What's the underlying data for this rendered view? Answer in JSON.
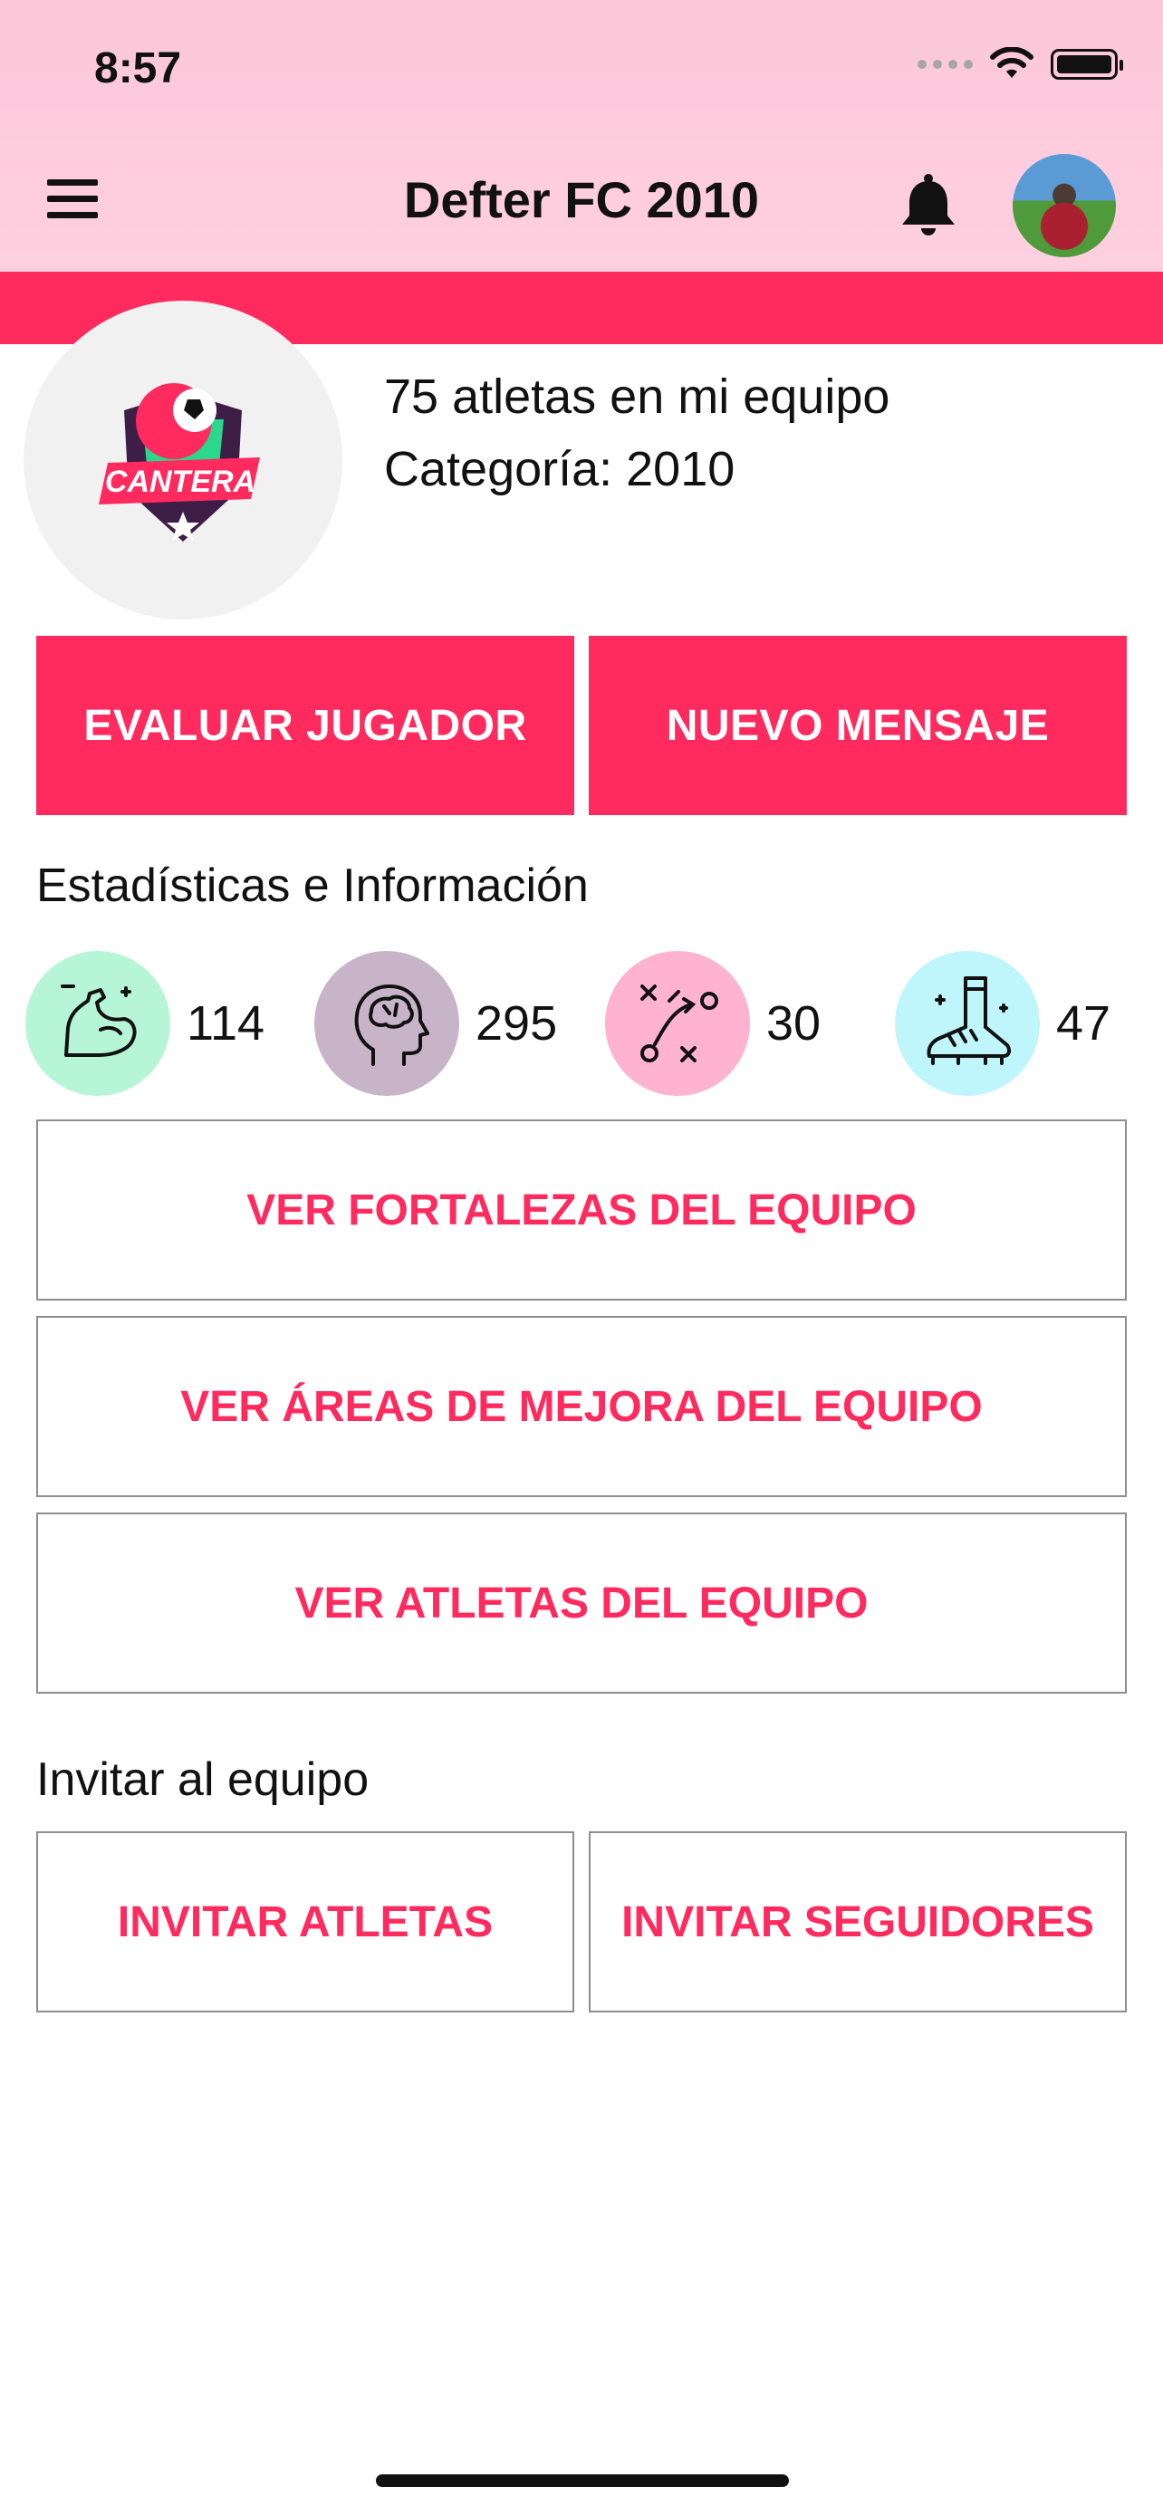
{
  "status_bar": {
    "time": "8:57"
  },
  "nav": {
    "title": "Defter FC 2010"
  },
  "team": {
    "athletes_count_text": "75 atletas en mi equipo",
    "category_text": "Categoría: 2010",
    "logo_text": "CANTERA"
  },
  "actions": {
    "evaluate_label": "EVALUAR JUGADOR",
    "message_label": "NUEVO MENSAJE"
  },
  "stats": {
    "section_title": "Estadísticas e Información",
    "items": [
      {
        "icon": "muscle-icon",
        "value": "114",
        "color": "#b6f5d6"
      },
      {
        "icon": "brain-head-icon",
        "value": "295",
        "color": "#c8b4c8"
      },
      {
        "icon": "tactics-icon",
        "value": "30",
        "color": "#ffb3cf"
      },
      {
        "icon": "soccer-boot-icon",
        "value": "47",
        "color": "#bff6fb"
      }
    ]
  },
  "links": {
    "strengths_label": "VER FORTALEZAS DEL EQUIPO",
    "improvement_label": "VER ÁREAS DE MEJORA DEL EQUIPO",
    "athletes_label": "VER ATLETAS DEL EQUIPO"
  },
  "invite": {
    "section_title": "Invitar al equipo",
    "athletes_label": "INVITAR ATLETAS",
    "followers_label": "INVITAR SEGUIDORES"
  },
  "colors": {
    "accent": "#ff2b5f",
    "header_bg": "#fdcadb"
  }
}
